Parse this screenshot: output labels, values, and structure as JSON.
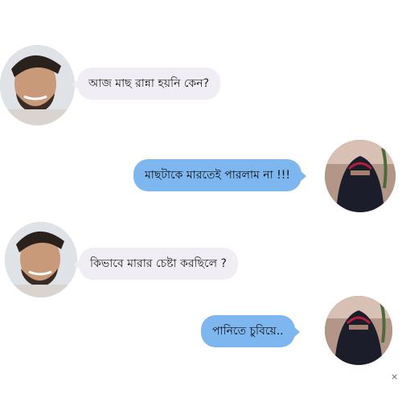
{
  "messages": [
    {
      "text": "আজ মাছ রান্না হয়নি কেন?",
      "side": "incoming"
    },
    {
      "text": "মাছটাকে মারতেই পারলাম না !!!",
      "side": "outgoing"
    },
    {
      "text": "কিভাবে মারার চেষ্টা করছিলে ?",
      "side": "incoming"
    },
    {
      "text": "পানিতে চুবিয়ে..",
      "side": "outgoing"
    }
  ],
  "close_glyph": "×",
  "colors": {
    "incoming_bubble": "#f0eef4",
    "outgoing_bubble": "#7eb6f0"
  }
}
